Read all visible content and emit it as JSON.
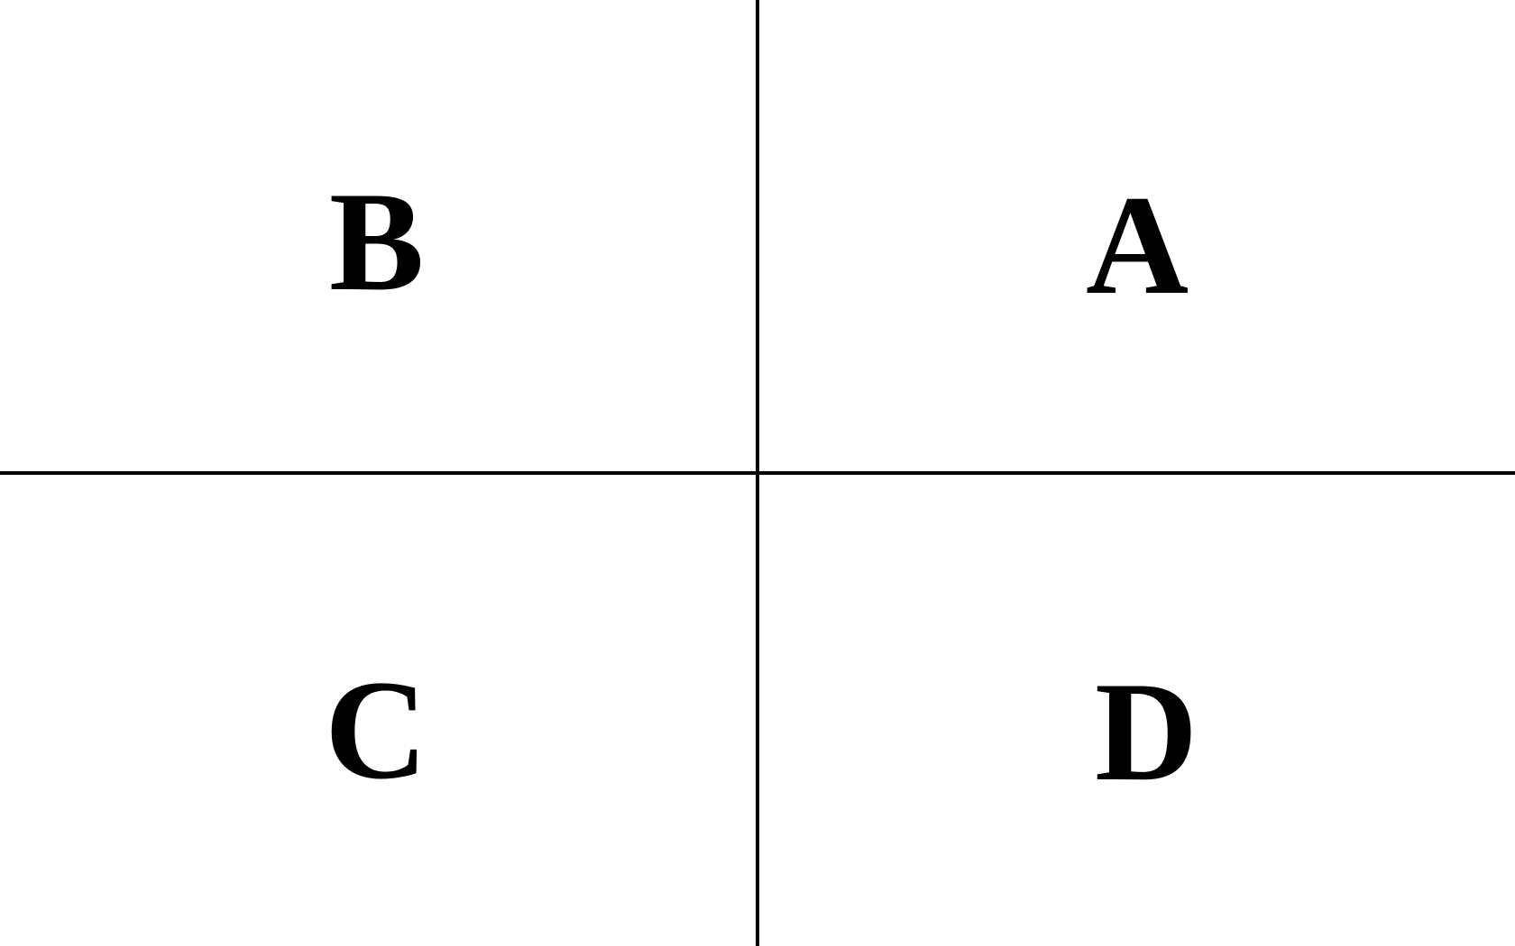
{
  "diagram": {
    "quadrants": {
      "top_left": "B",
      "top_right": "A",
      "bottom_left": "C",
      "bottom_right": "D"
    },
    "colors": {
      "background": "#ffffff",
      "lines": "#000000",
      "text": "#000000"
    }
  }
}
